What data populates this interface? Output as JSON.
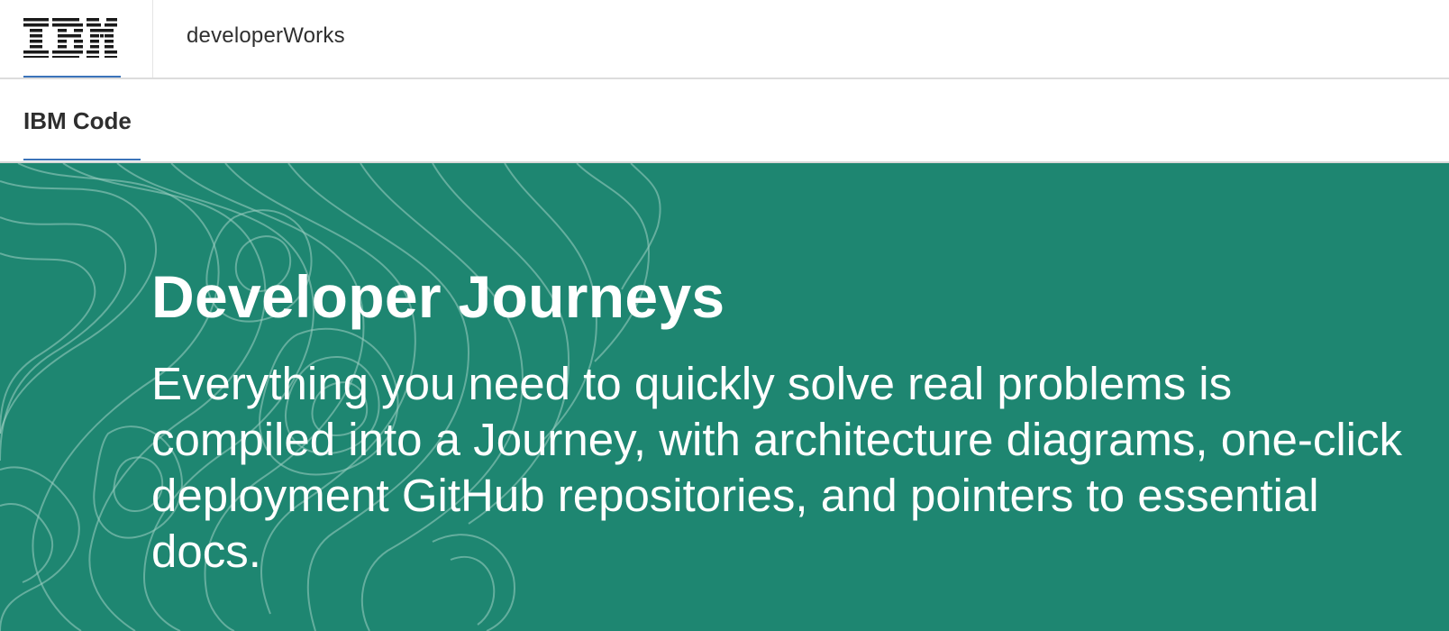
{
  "header": {
    "logo_text": "IBM",
    "product_name": "developerWorks"
  },
  "subnav": {
    "title": "IBM Code"
  },
  "hero": {
    "title": "Developer Journeys",
    "description": "Everything you need to quickly solve real problems is compiled into a Journey, with architecture diagrams, one-click deployment GitHub repositories, and pointers to essential docs.",
    "background_color": "#1e8671"
  },
  "colors": {
    "accent_underline": "#3b73b9",
    "text_dark": "#2e2e2e"
  },
  "icons": {
    "logo": "ibm-logo-icon",
    "background": "topographic-contour-pattern"
  }
}
